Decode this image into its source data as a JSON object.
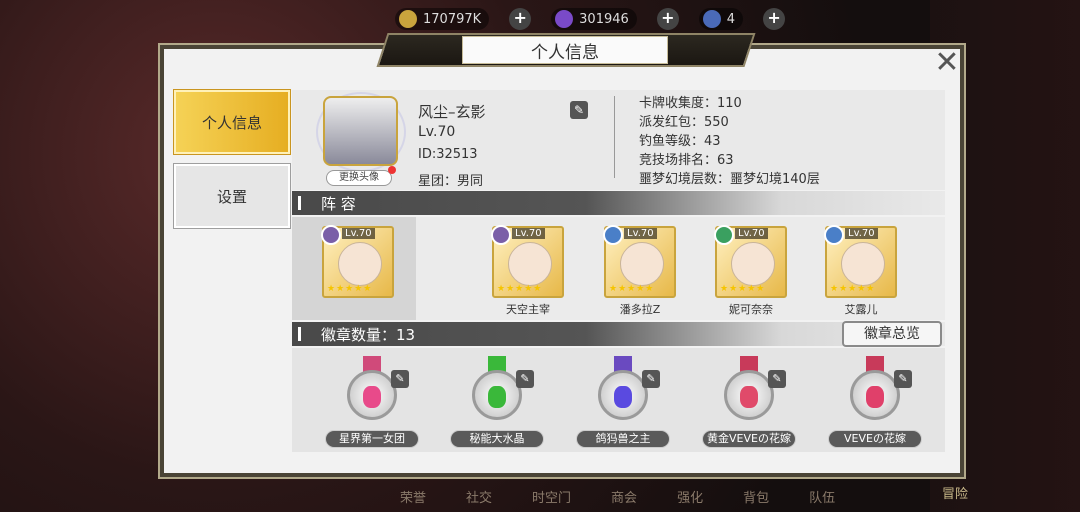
{
  "top": {
    "gold": "170797K",
    "gems": "301946",
    "tickets": "4",
    "player_lv": "Lv.70"
  },
  "title": "个人信息",
  "tabs": [
    "个人信息",
    "设置"
  ],
  "profile": {
    "name": "风尘–玄影",
    "level": "Lv.70",
    "id": "ID:32513",
    "guild": "星团：男同",
    "change_avatar": "更换头像"
  },
  "stats": [
    "卡牌收集度：110",
    "派发红包：550",
    "钓鱼等级：43",
    "竞技场排名：63",
    "噩梦幻境层数：噩梦幻境140层"
  ],
  "lineup": {
    "title": "阵 容",
    "members": [
      {
        "lv": "Lv.70",
        "name": "",
        "color": "#7a5fa8",
        "icon": "portrait-icon"
      },
      {
        "lv": "Lv.70",
        "name": "天空主宰",
        "color": "#7a5fa8",
        "icon": "shield-icon"
      },
      {
        "lv": "Lv.70",
        "name": "潘多拉Z",
        "color": "#4a7fc8",
        "icon": "swords-icon"
      },
      {
        "lv": "Lv.70",
        "name": "妮可奈奈",
        "color": "#3aa060",
        "icon": "cross-icon"
      },
      {
        "lv": "Lv.70",
        "name": "艾露儿",
        "color": "#4a7fc8",
        "icon": "bow-icon"
      }
    ]
  },
  "badges": {
    "title": "徽章数量：13",
    "all_button": "徽章总览",
    "items": [
      {
        "label": "星界第一女团",
        "gem": "#e84a8a",
        "ribbon": "#d04a7a"
      },
      {
        "label": "秘能大水晶",
        "gem": "#3ab83a",
        "ribbon": "#3ab83a"
      },
      {
        "label": "鸽犸兽之主",
        "gem": "#5a4ae0",
        "ribbon": "#6a4ac0"
      },
      {
        "label": "黄金VEVEの花嫁",
        "gem": "#e04a6a",
        "ribbon": "#c83a5a"
      },
      {
        "label": "VEVEの花嫁",
        "gem": "#e0406a",
        "ribbon": "#c83a5a"
      }
    ]
  },
  "nav": [
    "荣誉",
    "社交",
    "时空门",
    "商会",
    "强化",
    "背包",
    "队伍"
  ],
  "adventure": "冒险"
}
